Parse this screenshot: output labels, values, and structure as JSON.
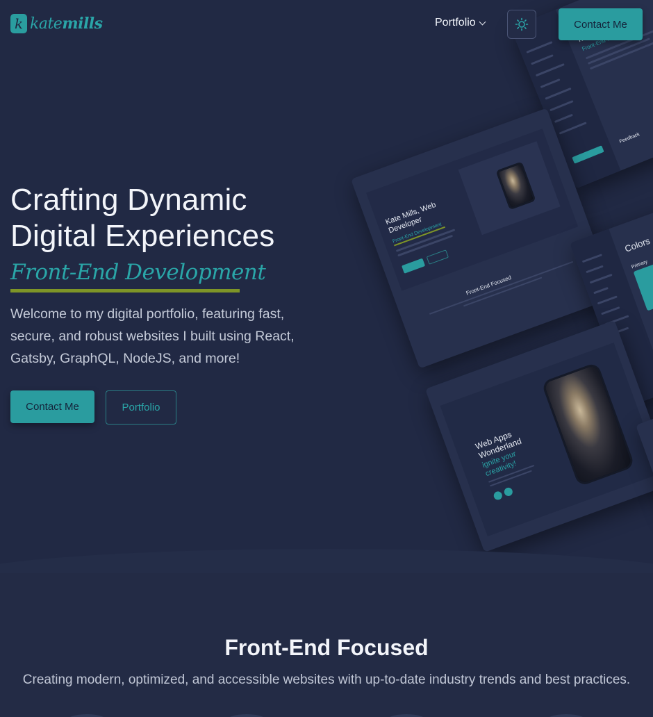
{
  "header": {
    "logo_letter": "k",
    "logo_name_light": "kate",
    "logo_name_bold": "mills",
    "nav_portfolio": "Portfolio",
    "theme_icon": "sun-icon",
    "contact_label": "Contact Me"
  },
  "hero": {
    "title": "Crafting Dynamic Digital Experiences",
    "subtitle": "Front-End Development",
    "description": "Welcome to my digital portfolio, featuring fast, secure, and robust websites I built using React, Gatsby, GraphQL, NodeJS, and more!",
    "primary_cta": "Contact Me",
    "secondary_cta": "Portfolio"
  },
  "mockups": {
    "card_a_title": "Kate Mills, Web Developer",
    "card_a_sub": "Front-End Development",
    "card_a_section": "Front-End Focused",
    "card_b_title": "Kate Mills Portfolio",
    "card_b_sub": "Front-End Web Developer",
    "card_b_feedback": "Feedback",
    "card_c_title_white": "Web Apps Wonderland",
    "card_c_title_teal": "ignite your creativity!",
    "card_d_title": "Colors",
    "card_d_label": "Primary"
  },
  "section": {
    "title": "Front-End Focused",
    "description": "Creating modern, optimized, and accessible websites with up-to-date industry trends and best practices."
  },
  "colors": {
    "accent": "#2a9c9f",
    "underline": "#7e9527",
    "background": "#212944"
  }
}
